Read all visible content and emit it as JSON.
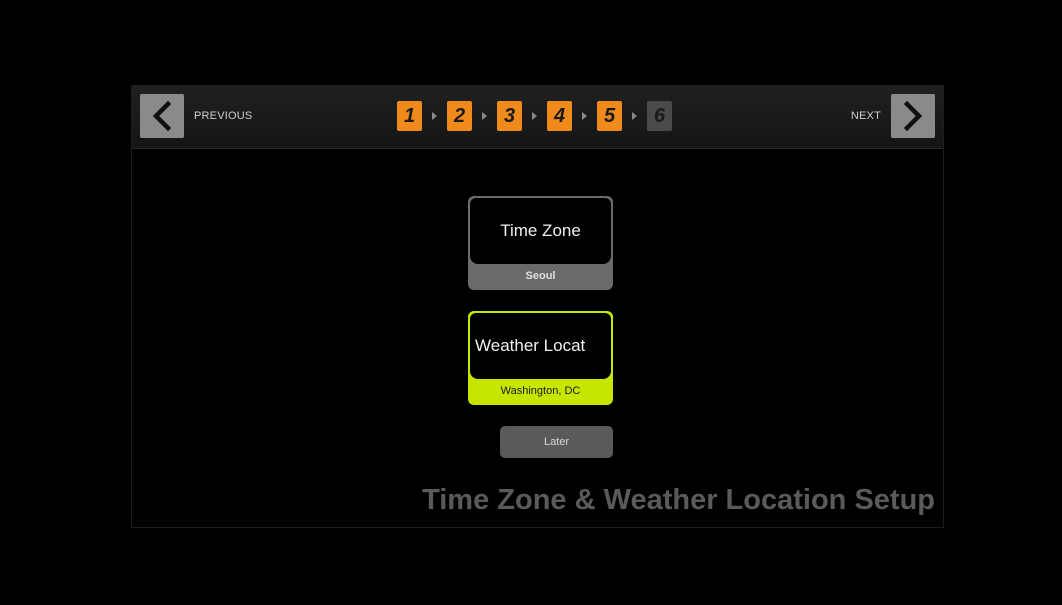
{
  "nav": {
    "previous_label": "PREVIOUS",
    "next_label": "NEXT",
    "button_color": "#8a8a8a"
  },
  "steps": {
    "items": [
      "1",
      "2",
      "3",
      "4",
      "5",
      "6"
    ],
    "completed_count": 5,
    "current": "6",
    "completed_color": "#f08a1c"
  },
  "time_zone_card": {
    "title": "Time Zone",
    "value": "Seoul"
  },
  "weather_card": {
    "title": "Weather Locat",
    "value": "Washington, DC",
    "highlight_color": "#c6e600"
  },
  "later_button": {
    "label": "Later"
  },
  "page_title": "Time Zone & Weather Location Setup"
}
